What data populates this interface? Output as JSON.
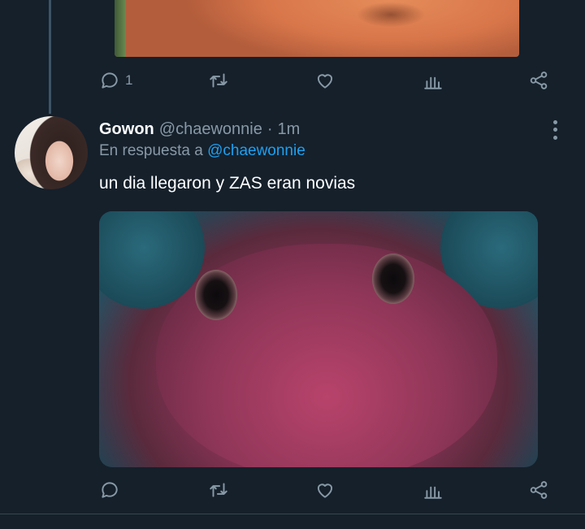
{
  "previous_tweet": {
    "actions": {
      "reply_count": "1",
      "retweet_count": "",
      "like_count": ""
    }
  },
  "tweet": {
    "author_name": "Gowon",
    "author_handle": "@chaewonnie",
    "separator": "·",
    "time": "1m",
    "reply_prefix": "En respuesta a",
    "reply_mention": "@chaewonnie",
    "text": "un dia llegaron y ZAS eran novias",
    "actions": {
      "reply_count": "",
      "retweet_count": "",
      "like_count": ""
    }
  },
  "colors": {
    "background": "#15202b",
    "secondary_text": "#8899a6",
    "link": "#1da1f2",
    "divider": "#38444d"
  },
  "icons": [
    "reply-icon",
    "retweet-icon",
    "like-icon",
    "analytics-icon",
    "share-icon",
    "more-options-icon"
  ]
}
